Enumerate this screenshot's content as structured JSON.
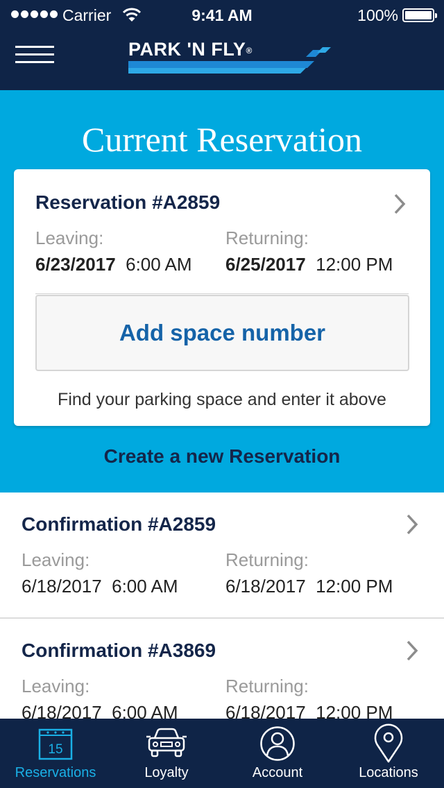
{
  "status_bar": {
    "carrier": "Carrier",
    "time": "9:41 AM",
    "battery": "100%"
  },
  "header": {
    "logo_text": "PARK 'N FLY",
    "logo_mark": "®"
  },
  "hero": {
    "title": "Current Reservation"
  },
  "current_reservation": {
    "title": "Reservation #A2859",
    "leaving_label": "Leaving:",
    "leaving_date": "6/23/2017",
    "leaving_time": "6:00 AM",
    "returning_label": "Returning:",
    "returning_date": "6/25/2017",
    "returning_time": "12:00 PM",
    "add_space_label": "Add space number",
    "hint": "Find your parking space and enter it above"
  },
  "create_new_label": "Create a new Reservation",
  "confirmations": [
    {
      "title": "Confirmation #A2859",
      "leaving_label": "Leaving:",
      "leaving_date": "6/18/2017",
      "leaving_time": "6:00 AM",
      "returning_label": "Returning:",
      "returning_date": "6/18/2017",
      "returning_time": "12:00 PM"
    },
    {
      "title": "Confirmation #A3869",
      "leaving_label": "Leaving:",
      "leaving_date": "6/18/2017",
      "leaving_time": "6:00 AM",
      "returning_label": "Returning:",
      "returning_date": "6/18/2017",
      "returning_time": "12:00 PM"
    }
  ],
  "tabs": [
    {
      "label": "Reservations",
      "icon": "calendar-icon",
      "calendar_day": "15",
      "active": true
    },
    {
      "label": "Loyalty",
      "icon": "car-icon",
      "active": false
    },
    {
      "label": "Account",
      "icon": "user-icon",
      "active": false
    },
    {
      "label": "Locations",
      "icon": "location-pin-icon",
      "active": false
    }
  ],
  "colors": {
    "navy": "#0f2447",
    "hero_blue": "#00a9df",
    "link_blue": "#1563a8",
    "active_tab": "#1ab0e6"
  }
}
